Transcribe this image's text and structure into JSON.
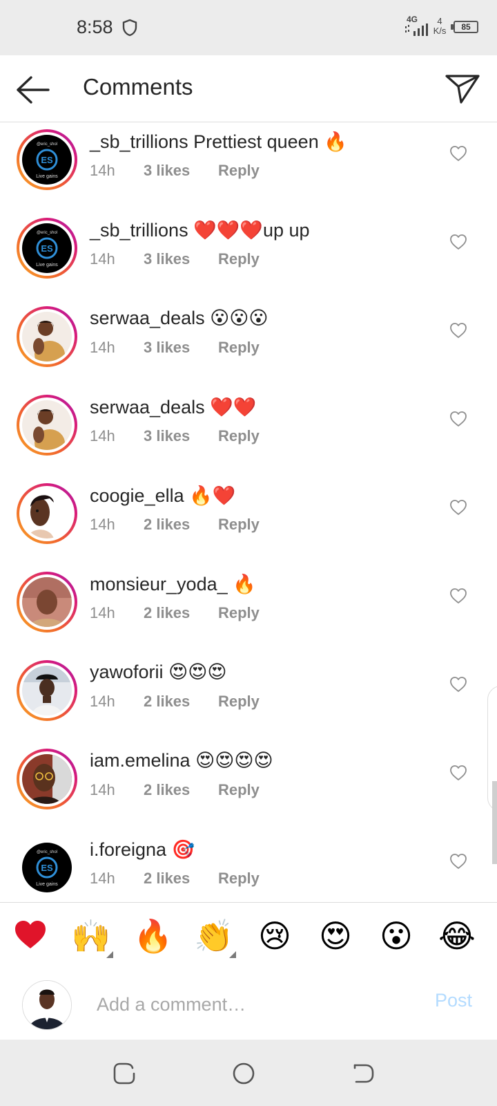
{
  "status_bar": {
    "time": "8:58",
    "network_label": "4G",
    "speed_value": "4",
    "speed_unit": "K/s",
    "battery": "85"
  },
  "header": {
    "title": "Comments"
  },
  "comments": [
    {
      "username": "_sb_trillions",
      "body": "Prettiest queen 🔥",
      "time": "14h",
      "likes": "3 likes",
      "reply": "Reply"
    },
    {
      "username": "_sb_trillions",
      "body": "❤️❤️❤️up up",
      "time": "14h",
      "likes": "3 likes",
      "reply": "Reply"
    },
    {
      "username": "serwaa_deals",
      "body": "😮😮😮",
      "time": "14h",
      "likes": "3 likes",
      "reply": "Reply"
    },
    {
      "username": "serwaa_deals",
      "body": "❤️❤️",
      "time": "14h",
      "likes": "3 likes",
      "reply": "Reply"
    },
    {
      "username": "coogie_ella",
      "body": "🔥❤️",
      "time": "14h",
      "likes": "2 likes",
      "reply": "Reply"
    },
    {
      "username": "monsieur_yoda_",
      "body": "🔥",
      "time": "14h",
      "likes": "2 likes",
      "reply": "Reply"
    },
    {
      "username": "yawoforii",
      "body": "😍😍😍",
      "time": "14h",
      "likes": "2 likes",
      "reply": "Reply"
    },
    {
      "username": "iam.emelina",
      "body": "😍😍😍😍",
      "time": "14h",
      "likes": "2 likes",
      "reply": "Reply"
    },
    {
      "username": "i.foreigna",
      "body": "🎯",
      "time": "14h",
      "likes": "2 likes",
      "reply": "Reply"
    }
  ],
  "avatar_logo_text": {
    "handle": "@eric_shol",
    "initials": "ES",
    "tagline": "Live gains"
  },
  "quick_reactions": [
    "❤️",
    "🙌",
    "🔥",
    "👏",
    "😢",
    "😍",
    "😮",
    "😂"
  ],
  "composer": {
    "placeholder": "Add a comment…",
    "post_label": "Post"
  },
  "colors": {
    "post_disabled": "#b3dbff",
    "meta_gray": "#8e8e8e",
    "story_ring_start": "#f9a825",
    "story_ring_end": "#a020b0"
  }
}
